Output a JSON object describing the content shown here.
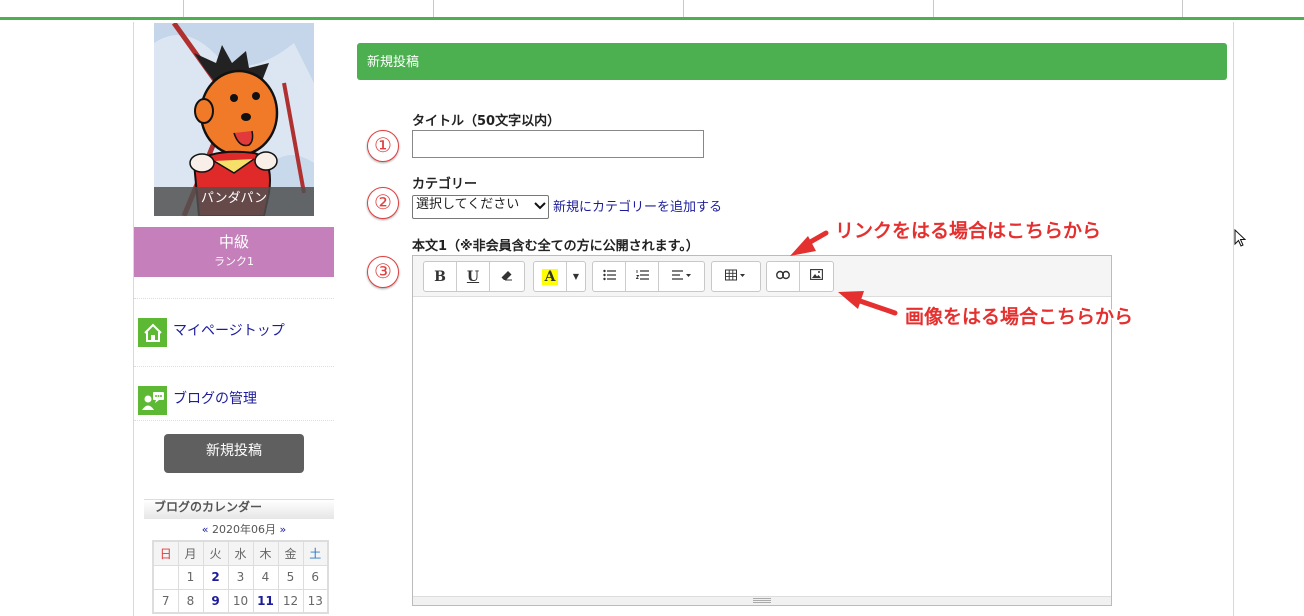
{
  "nav": {
    "tabs": [
      "",
      "",
      "",
      "",
      ""
    ]
  },
  "sidebar": {
    "avatar_name": "パンダパン",
    "rank": {
      "level": "中級",
      "rank_label": "ランク1"
    },
    "links": [
      {
        "label": "マイページトップ",
        "icon": "home-icon"
      },
      {
        "label": "ブログの管理",
        "icon": "blog-manage-icon"
      }
    ],
    "new_post_button": "新規投稿",
    "calendar": {
      "title": "ブログのカレンダー",
      "prev": "«",
      "next": "»",
      "month": "2020年06月",
      "weekdays": [
        "日",
        "月",
        "火",
        "水",
        "木",
        "金",
        "土"
      ],
      "rows": [
        [
          "",
          "1",
          "2",
          "3",
          "4",
          "5",
          "6"
        ],
        [
          "7",
          "8",
          "9",
          "10",
          "11",
          "12",
          "13"
        ]
      ],
      "linked_days": [
        "2",
        "9",
        "11"
      ]
    }
  },
  "main": {
    "header": "新規投稿",
    "steps": [
      "①",
      "②",
      "③"
    ],
    "title_label": "タイトル（50文字以内）",
    "title_value": "",
    "category_label": "カテゴリー",
    "category_selected": "選択してください",
    "add_category_link": "新規にカテゴリーを追加する",
    "body_label": "本文1（※非会員含む全ての方に公開されます。）",
    "toolbar": {
      "bold": "B",
      "underline": "U",
      "eraser": "eraser-icon",
      "color": "A",
      "ul": "unordered-list-icon",
      "ol": "ordered-list-icon",
      "align": "align-icon",
      "table": "table-icon",
      "link": "link-icon",
      "image": "image-icon"
    },
    "body_value": ""
  },
  "annotations": {
    "link_hint": "リンクをはる場合はこちらから",
    "image_hint": "画像をはる場合こちらから"
  },
  "colors": {
    "accent_green": "#4caf50",
    "rank_purple": "#c57fbb",
    "annotation_red": "#e53030",
    "link_blue": "#1d1d9b"
  }
}
